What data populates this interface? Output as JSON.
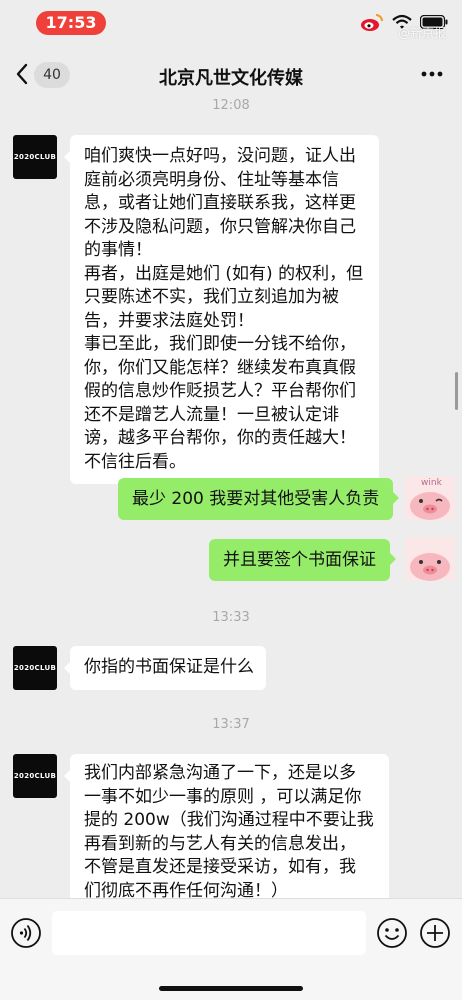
{
  "status_bar": {
    "time": "17:53",
    "icons": [
      "weibo-icon",
      "wifi-icon",
      "battery-icon"
    ],
    "watermark": "@新京报"
  },
  "nav": {
    "back_icon": "chevron-left-icon",
    "unread_count": "40",
    "title": "北京凡世文化传媒",
    "more_icon": "more-dots-icon"
  },
  "avatars": {
    "contact_logo": "2020CLUB",
    "self_label": "wink"
  },
  "messages": {
    "t1": "12:08",
    "m1": "咱们爽快一点好吗，没问题，证人出\n庭前必须亮明身份、住址等基本信\n息，或者让她们直接联系我，这样更\n不涉及隐私问题，你只管解决你自己\n的事情！\n再者，出庭是她们 (如有) 的权利，但\n只要陈述不实，我们立刻追加为被\n告，并要求法庭处罚！\n事已至此，我们即使一分钱不给你，\n你，你们又能怎样？继续发布真真假\n假的信息炒作贬损艺人？平台帮你们\n还不是蹭艺人流量！一旦被认定诽\n谤，越多平台帮你，你的责任越大！\n不信往后看。",
    "m2": "最少 200 我要对其他受害人负责",
    "m3": "并且要签个书面保证",
    "t2": "13:33",
    "m4": "你指的书面保证是什么",
    "t3": "13:37",
    "m5": "我们内部紧急沟通了一下，还是以多\n一事不如少一事的原则 ，可以满足你\n提的 200w（我们沟通过程中不要让我\n再看到新的与艺人有关的信息发出，\n不管是直发还是接受采访，如有，我\n们彻底不再作任何沟通！）"
  },
  "input_bar": {
    "voice_icon": "voice-icon",
    "input_value": "",
    "emoji_icon": "emoji-icon",
    "plus_icon": "plus-icon"
  },
  "colors": {
    "background": "#ededed",
    "sent_bubble": "#95ec69",
    "received_bubble": "#ffffff",
    "time_pill": "#ef4139"
  }
}
